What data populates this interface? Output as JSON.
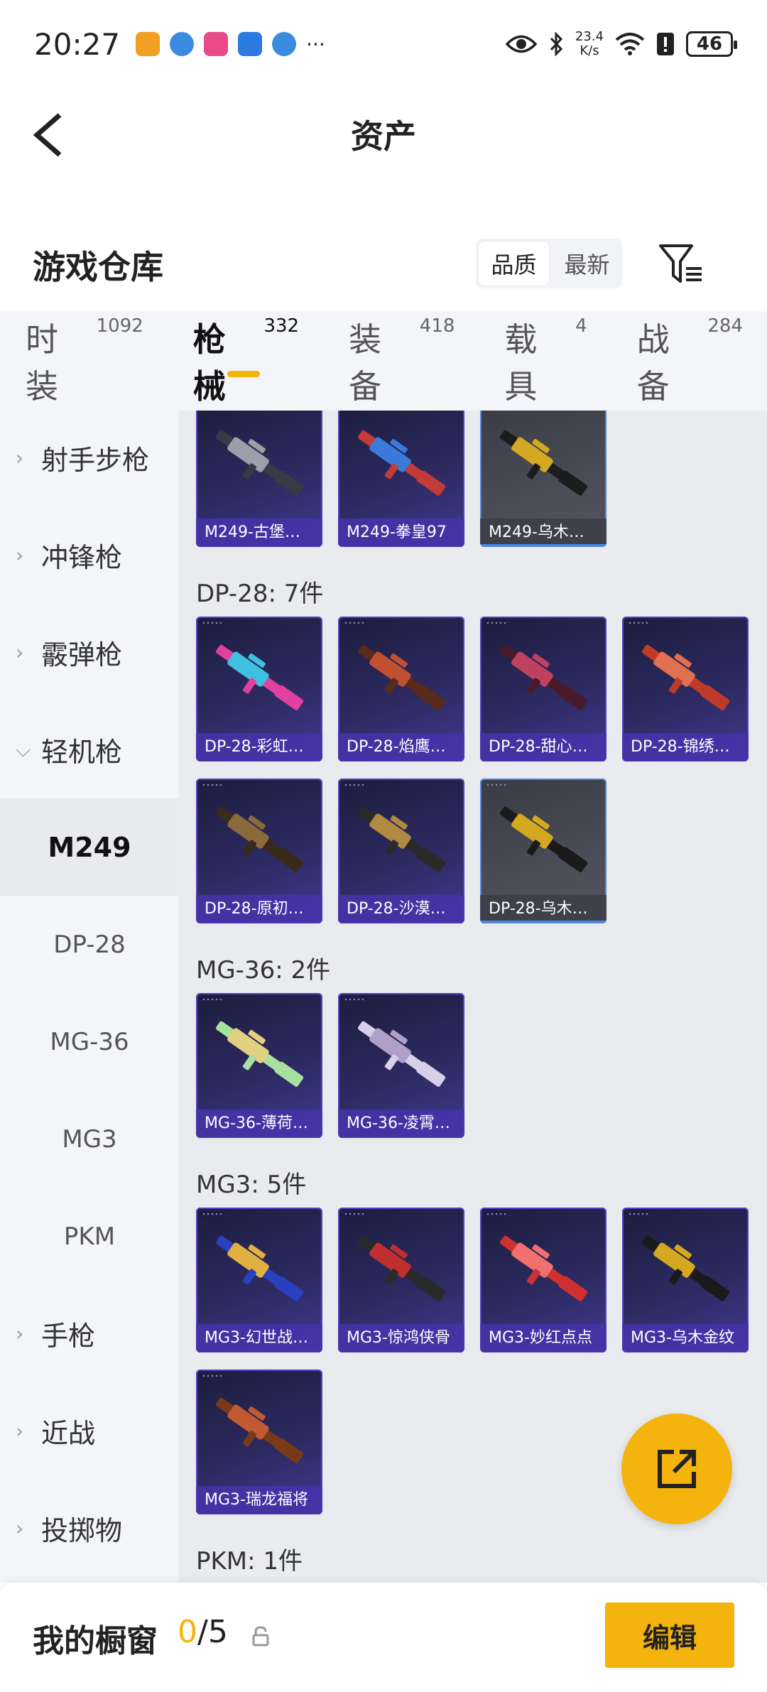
{
  "status_bar": {
    "time": "20:27",
    "more": "···",
    "net_speed_value": "23.4",
    "net_speed_unit": "K/s",
    "battery": "46"
  },
  "header": {
    "title": "资产"
  },
  "warehouse": {
    "title": "游戏仓库",
    "sort_options": [
      "品质",
      "最新"
    ],
    "sort_active": "品质"
  },
  "tabs": [
    {
      "label": "时装",
      "count": "1092",
      "active": false
    },
    {
      "label": "枪械",
      "count": "332",
      "active": true
    },
    {
      "label": "装备",
      "count": "418",
      "active": false
    },
    {
      "label": "载具",
      "count": "4",
      "active": false
    },
    {
      "label": "战备",
      "count": "284",
      "active": false
    }
  ],
  "sidebar": {
    "items": [
      {
        "label": "射手步枪",
        "type": "category"
      },
      {
        "label": "冲锋枪",
        "type": "category"
      },
      {
        "label": "霰弹枪",
        "type": "category"
      },
      {
        "label": "轻机枪",
        "type": "category-open"
      },
      {
        "label": "M249",
        "type": "sub-active"
      },
      {
        "label": "DP-28",
        "type": "sub"
      },
      {
        "label": "MG-36",
        "type": "sub"
      },
      {
        "label": "MG3",
        "type": "sub"
      },
      {
        "label": "PKM",
        "type": "sub"
      },
      {
        "label": "手枪",
        "type": "category"
      },
      {
        "label": "近战",
        "type": "category"
      },
      {
        "label": "投掷物",
        "type": "category"
      }
    ]
  },
  "sections": [
    {
      "title": "",
      "items": [
        {
          "label": "M249-古堡…",
          "grey": false,
          "colors": [
            "#3a3a44",
            "#9aa0a8"
          ]
        },
        {
          "label": "M249-拳皇97",
          "grey": false,
          "colors": [
            "#c23a3a",
            "#3a7ad8"
          ]
        },
        {
          "label": "M249-乌木…",
          "grey": true,
          "colors": [
            "#1c1c1c",
            "#d4a820"
          ]
        }
      ]
    },
    {
      "title": "DP-28: 7件",
      "items": [
        {
          "label": "DP-28-彩虹…",
          "grey": false,
          "colors": [
            "#e040a0",
            "#40c0e0"
          ]
        },
        {
          "label": "DP-28-焰鹰…",
          "grey": false,
          "colors": [
            "#5a2a1a",
            "#c05030"
          ]
        },
        {
          "label": "DP-28-甜心…",
          "grey": false,
          "colors": [
            "#4a1a2a",
            "#c04060"
          ]
        },
        {
          "label": "DP-28-锦绣…",
          "grey": false,
          "colors": [
            "#c03a2a",
            "#e07050"
          ]
        },
        {
          "label": "DP-28-原初…",
          "grey": false,
          "colors": [
            "#3a2a1a",
            "#8a6a3a"
          ]
        },
        {
          "label": "DP-28-沙漠…",
          "grey": false,
          "colors": [
            "#2a2a2a",
            "#b08a40"
          ]
        },
        {
          "label": "DP-28-乌木…",
          "grey": true,
          "colors": [
            "#1a1a1a",
            "#d4a820"
          ]
        }
      ]
    },
    {
      "title": "MG-36: 2件",
      "items": [
        {
          "label": "MG-36-薄荷…",
          "grey": false,
          "colors": [
            "#a8e0a0",
            "#e0d080"
          ]
        },
        {
          "label": "MG-36-凌霄…",
          "grey": false,
          "colors": [
            "#d8d0e8",
            "#b0a0c8"
          ]
        }
      ]
    },
    {
      "title": "MG3: 5件",
      "items": [
        {
          "label": "MG3-幻世战…",
          "grey": false,
          "colors": [
            "#2a40c0",
            "#e0b040"
          ]
        },
        {
          "label": "MG3-惊鸿侠骨",
          "grey": false,
          "colors": [
            "#2a2a2a",
            "#c03030"
          ]
        },
        {
          "label": "MG3-妙红点点",
          "grey": false,
          "colors": [
            "#d03030",
            "#f07070"
          ]
        },
        {
          "label": "MG3-乌木金纹",
          "grey": false,
          "colors": [
            "#1a1a1a",
            "#d4a820"
          ]
        },
        {
          "label": "MG3-瑞龙福将",
          "grey": false,
          "colors": [
            "#7a3a1a",
            "#c05a30"
          ]
        }
      ]
    },
    {
      "title": "PKM: 1件",
      "items": [
        {
          "label": "",
          "grey": false,
          "colors": [
            "#40a0a0",
            "#3a3a44"
          ]
        }
      ]
    }
  ],
  "bottom_bar": {
    "title": "我的橱窗",
    "count_current": "0",
    "count_sep": "/",
    "count_total": "5",
    "edit_label": "编辑"
  },
  "fab": {
    "icon": "share-external-icon"
  }
}
